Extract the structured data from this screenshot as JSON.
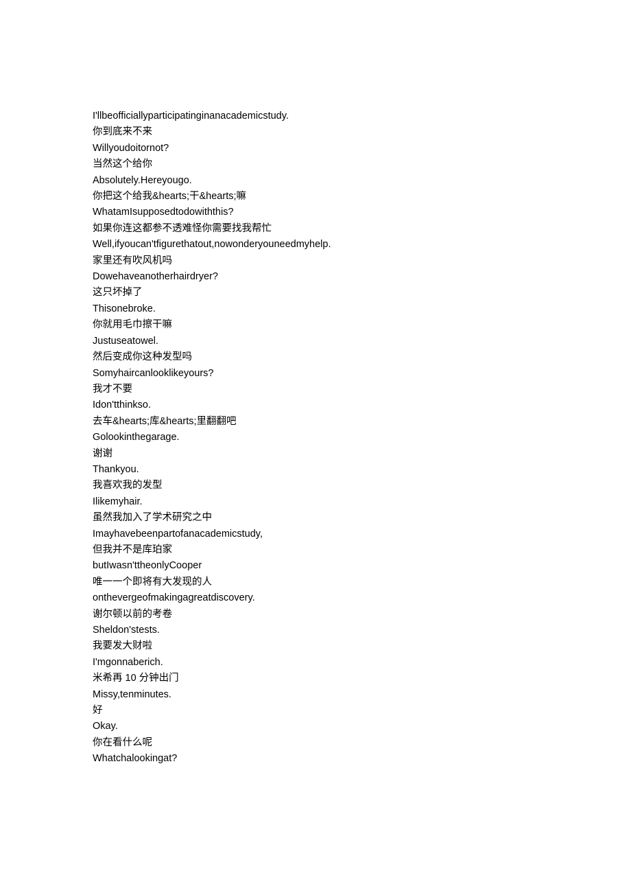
{
  "lines": [
    "I'llbeofficiallyparticipatinginanacademicstudy.",
    "你到底来不来",
    "Willyoudoitornot?",
    "当然这个给你",
    "Absolutely.Hereyougo.",
    "你把这个给我&hearts;干&hearts;嘛",
    "WhatamIsupposedtodowiththis?",
    "如果你连这都参不透难怪你需要找我帮忙",
    "Well,ifyoucan'tfigurethatout,nowonderyouneedmyhelp.",
    "家里还有吹风机吗",
    "Dowehaveanotherhairdryer?",
    "这只坏掉了",
    "Thisonebroke.",
    "你就用毛巾擦干嘛",
    "Justuseatowel.",
    "然后变成你这种发型吗",
    "Somyhaircanlooklikeyours?",
    "我才不要",
    "Idon'tthinkso.",
    "去车&hearts;库&hearts;里翻翻吧",
    "Golookinthegarage.",
    "谢谢",
    "Thankyou.",
    "我喜欢我的发型",
    "Ilikemyhair.",
    "虽然我加入了学术研究之中",
    "Imayhavebeenpartofanacademicstudy,",
    "但我并不是库珀家",
    "butIwasn'ttheonlyCooper",
    "唯一一个即将有大发现的人",
    "onthevergeofmakingagreatdiscovery.",
    "谢尔顿以前的考卷",
    "Sheldon'stests.",
    "我要发大财啦",
    "I'mgonnaberich.",
    "米希再 10 分钟出门",
    "Missy,tenminutes.",
    "好",
    "Okay.",
    "你在看什么呢",
    "Whatchalookingat?"
  ]
}
